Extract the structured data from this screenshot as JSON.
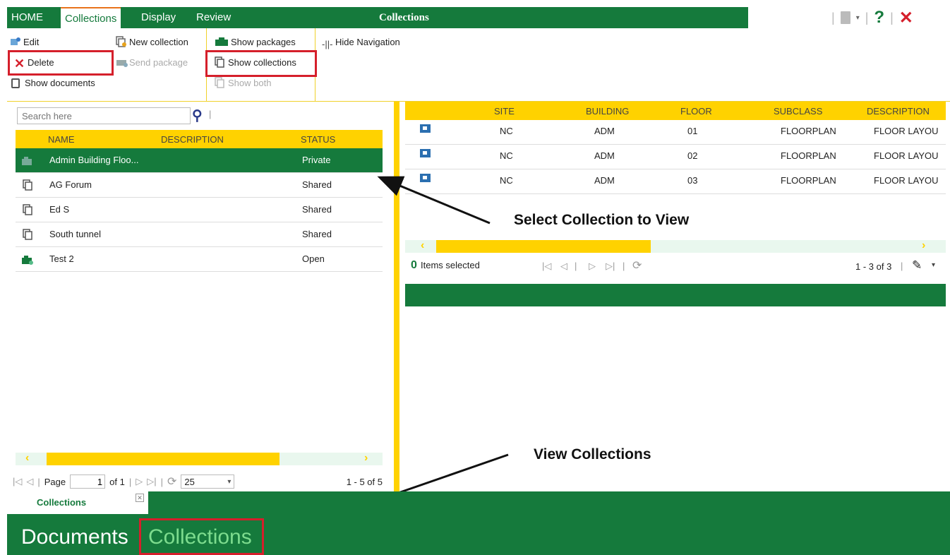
{
  "tabs": {
    "home": "HOME",
    "collections": "Collections",
    "display": "Display",
    "review": "Review"
  },
  "ribbon_title": "Collections",
  "top_right": {
    "help": "?",
    "close": "✕"
  },
  "ribbon": {
    "edit": "Edit",
    "delete": "Delete",
    "show_documents": "Show documents",
    "new_collection": "New collection",
    "send_package": "Send package",
    "show_packages": "Show packages",
    "show_collections": "Show collections",
    "show_both": "Show both",
    "hide_navigation": "Hide Navigation"
  },
  "search": {
    "placeholder": "Search here"
  },
  "left_table": {
    "headers": {
      "name": "NAME",
      "description": "DESCRIPTION",
      "status": "STATUS"
    },
    "rows": [
      {
        "name": "Admin Building Floo...",
        "status": "Private",
        "icon": "package-icon"
      },
      {
        "name": "AG Forum",
        "status": "Shared",
        "icon": "collection-icon"
      },
      {
        "name": "Ed S",
        "status": "Shared",
        "icon": "collection-icon"
      },
      {
        "name": "South tunnel",
        "status": "Shared",
        "icon": "collection-icon"
      },
      {
        "name": "Test 2",
        "status": "Open",
        "icon": "package-icon"
      }
    ]
  },
  "left_pager": {
    "page_label": "Page",
    "page": "1",
    "of": "of 1",
    "page_size": "25",
    "range": "1 - 5 of 5"
  },
  "right_table": {
    "headers": {
      "site": "SITE",
      "building": "BUILDING",
      "floor": "FLOOR",
      "subclass": "SUBCLASS",
      "description": "DESCRIPTION"
    },
    "rows": [
      {
        "site": "NC",
        "building": "ADM",
        "floor": "01",
        "subclass": "FLOORPLAN",
        "description": "FLOOR LAYOU"
      },
      {
        "site": "NC",
        "building": "ADM",
        "floor": "02",
        "subclass": "FLOORPLAN",
        "description": "FLOOR LAYOU"
      },
      {
        "site": "NC",
        "building": "ADM",
        "floor": "03",
        "subclass": "FLOORPLAN",
        "description": "FLOOR LAYOU"
      }
    ]
  },
  "right_pager": {
    "count": "0",
    "items_selected": "Items selected",
    "range": "1 - 3 of 3"
  },
  "bottom": {
    "tab_label": "Collections",
    "documents": "Documents",
    "collections": "Collections"
  },
  "annotations": {
    "select": "Select Collection to View",
    "view": "View Collections"
  },
  "colors": {
    "green": "#157a3c",
    "yellow": "#ffd200",
    "red": "#d51f2b",
    "light_green": "#7ddc8e"
  }
}
